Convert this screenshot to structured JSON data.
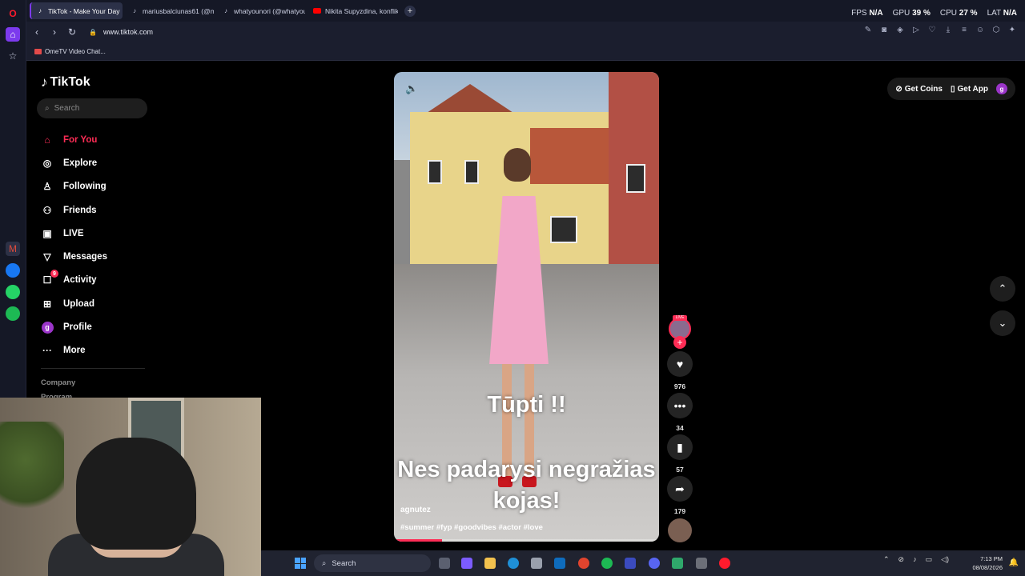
{
  "browser": {
    "tabs": [
      {
        "label": "TikTok - Make Your Day",
        "active": true
      },
      {
        "label": "mariusbalciunas61 (@mar",
        "active": false
      },
      {
        "label": "whatyounori (@whatyoun",
        "active": false
      },
      {
        "label": "Nikita Supyzdina, konflikta",
        "active": false
      }
    ],
    "stats": {
      "fps_label": "FPS",
      "fps_value": "N/A",
      "gpu_label": "GPU",
      "gpu_value": "39 %",
      "cpu_label": "CPU",
      "cpu_value": "27 %",
      "lat_label": "LAT",
      "lat_value": "N/A"
    },
    "url": "www.tiktok.com",
    "bookmark": "OmeTV Video Chat..."
  },
  "tiktok": {
    "logo": "TikTok",
    "search_placeholder": "Search",
    "menu": [
      {
        "label": "For You",
        "icon": "home-icon"
      },
      {
        "label": "Explore",
        "icon": "compass-icon"
      },
      {
        "label": "Following",
        "icon": "user-follow-icon"
      },
      {
        "label": "Friends",
        "icon": "friends-icon"
      },
      {
        "label": "LIVE",
        "icon": "live-icon"
      },
      {
        "label": "Messages",
        "icon": "send-icon"
      },
      {
        "label": "Activity",
        "icon": "bell-icon",
        "badge": "9"
      },
      {
        "label": "Upload",
        "icon": "plus-square-icon"
      },
      {
        "label": "Profile",
        "icon": "avatar-icon",
        "avatar_letter": "g"
      },
      {
        "label": "More",
        "icon": "more-icon"
      }
    ],
    "footer": [
      "Company",
      "Program"
    ],
    "get_coins": "Get Coins",
    "get_app": "Get App",
    "user_avatar_letter": "g"
  },
  "video": {
    "caption_top": "Tūpti !!",
    "caption_bottom": "Nes padarysi negražias kojas!",
    "username": "agnutez",
    "tags": "#summer #fyp #goodvibes #actor #love",
    "likes": "976",
    "comments": "34",
    "saves": "57",
    "shares": "179",
    "live_tag": "LIVE",
    "progress": 0.18
  },
  "taskbar": {
    "search": "Search",
    "time": "7:13 PM",
    "date": "08/08/2026"
  },
  "colors": {
    "accent": "#fe2c55",
    "opera_purple": "#7c3aed"
  }
}
